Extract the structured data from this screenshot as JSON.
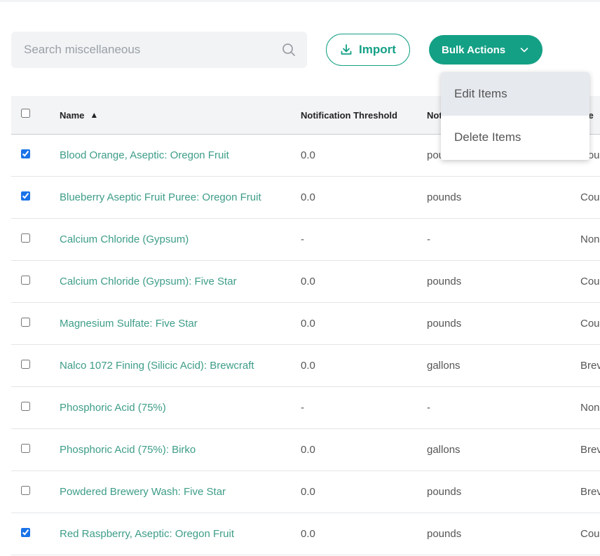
{
  "search": {
    "placeholder": "Search miscellaneous",
    "icon": "search-icon"
  },
  "toolbar": {
    "import_label": "Import",
    "bulk_label": "Bulk Actions",
    "accent": "#14a085"
  },
  "dropdown": {
    "items": [
      {
        "label": "Edit Items",
        "active": true
      },
      {
        "label": "Delete Items",
        "active": false
      }
    ]
  },
  "table": {
    "headers": {
      "name": "Name",
      "sort": "▲",
      "threshold": "Notification Threshold",
      "unit": "Not",
      "extra": "efe"
    },
    "rows": [
      {
        "checked": true,
        "name": "Blood Orange, Aseptic: Oregon Fruit",
        "threshold": "0.0",
        "unit": "pou",
        "extra": "Cou"
      },
      {
        "checked": true,
        "name": "Blueberry Aseptic Fruit Puree: Oregon Fruit",
        "threshold": "0.0",
        "unit": "pounds",
        "extra": "Cou"
      },
      {
        "checked": false,
        "name": "Calcium Chloride (Gypsum)",
        "threshold": "-",
        "unit": "-",
        "extra": "Non"
      },
      {
        "checked": false,
        "name": "Calcium Chloride (Gypsum): Five Star",
        "threshold": "0.0",
        "unit": "pounds",
        "extra": "Cou"
      },
      {
        "checked": false,
        "name": "Magnesium Sulfate: Five Star",
        "threshold": "0.0",
        "unit": "pounds",
        "extra": "Cou"
      },
      {
        "checked": false,
        "name": "Nalco 1072 Fining (Silicic Acid): Brewcraft",
        "threshold": "0.0",
        "unit": "gallons",
        "extra": "Brev"
      },
      {
        "checked": false,
        "name": "Phosphoric Acid (75%)",
        "threshold": "-",
        "unit": "-",
        "extra": "Non"
      },
      {
        "checked": false,
        "name": "Phosphoric Acid (75%): Birko",
        "threshold": "0.0",
        "unit": "gallons",
        "extra": "Brev"
      },
      {
        "checked": false,
        "name": "Powdered Brewery Wash: Five Star",
        "threshold": "0.0",
        "unit": "pounds",
        "extra": "Brev"
      },
      {
        "checked": true,
        "name": "Red Raspberry, Aseptic: Oregon Fruit",
        "threshold": "0.0",
        "unit": "pounds",
        "extra": "Cou"
      }
    ]
  }
}
